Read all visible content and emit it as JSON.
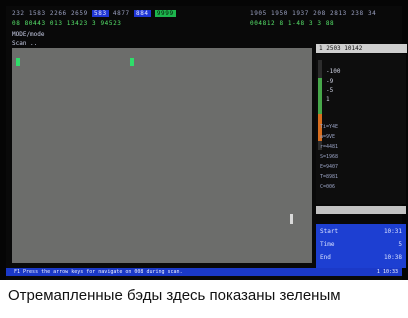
{
  "top_left": {
    "text_before": "232 1583 2266 2659",
    "highlight_1": "583",
    "text_mid": "4877",
    "highlight_2": "884",
    "highlight_3": "9999"
  },
  "top_right": {
    "text": "1905 1950 1937 208 2813 238 34"
  },
  "row2": {
    "left": "08 80443 013 13423 3 94523",
    "right": "004812 8 1-48 3 3 88"
  },
  "mode_label": "MODE/mode",
  "scan_label": "Scan ..",
  "right_header": "1 2503 10142",
  "scale_values": [
    "-100",
    "-9",
    "-5",
    "1"
  ],
  "param_labels": [
    "Ti=Y4E",
    "a=9VE",
    "r=4481",
    "S=1968",
    "E=9407",
    "T=8981",
    "C=006"
  ],
  "info": {
    "start_label": "Start",
    "start_value": "10:31",
    "time_label": "Time",
    "time_value": "5",
    "end_label": "End",
    "end_value": "10:38"
  },
  "status": {
    "message": "F1 Press the arrow keys for navigate on 008 during scan.",
    "right": "1 10:33"
  },
  "caption": "Отремапленные бэды здесь показаны зеленым",
  "colors": {
    "map_gray": "#6c6d6b",
    "green_marker": "#2fdc6a",
    "status_blue": "#1b39c8",
    "info_blue": "#1d3fd2"
  }
}
